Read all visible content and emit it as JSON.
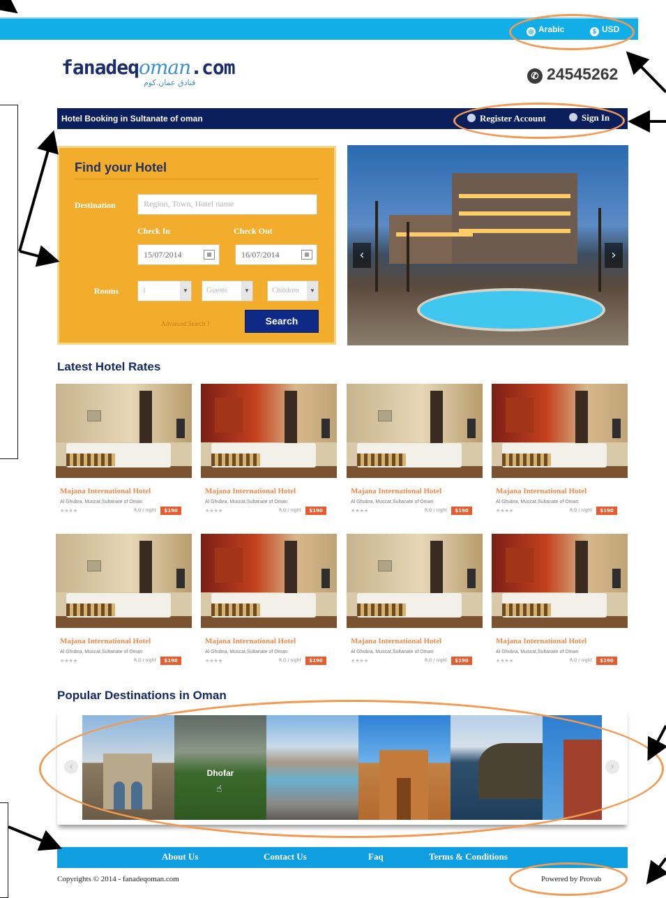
{
  "topbar": {
    "language_label": "Arabic",
    "currency_label": "USD"
  },
  "header": {
    "logo_part1": "fanadeq",
    "logo_part2": "oman",
    "logo_part3": ".com",
    "logo_arabic": "فنادق عمان.كوم",
    "phone": "24545262"
  },
  "navbar": {
    "title": "Hotel Booking in Sultanate of oman",
    "register_label": "Register Account",
    "signin_label": "Sign In"
  },
  "search": {
    "heading": "Find your Hotel",
    "destination_label": "Destination",
    "destination_placeholder": "Region, Town, Hotel name",
    "checkin_label": "Check In",
    "checkout_label": "Check Out",
    "checkin_value": "15/07/2014",
    "checkout_value": "16/07/2014",
    "rooms_label": "Rooms",
    "rooms_value": "1",
    "guests_value": "Guests",
    "children_value": "Children",
    "advanced_label": "Advanced Search ?",
    "search_button": "Search"
  },
  "latest": {
    "heading": "Latest Hotel Rates",
    "hotels": [
      {
        "name": "Majana International Hotel",
        "address": "Al Ghubra, Muscat,Sultanate of Oman",
        "stars": "★★★★",
        "per": "R.O / night",
        "price": "$190"
      },
      {
        "name": "Majana International Hotel",
        "address": "Al Ghubra, Muscat,Sultanate of Oman",
        "stars": "★★★★",
        "per": "R.O / night",
        "price": "$190"
      },
      {
        "name": "Majana International Hotel",
        "address": "Al Ghubra, Muscat,Sultanate of Oman",
        "stars": "★★★★",
        "per": "R.O / night",
        "price": "$190"
      },
      {
        "name": "Majana International Hotel",
        "address": "Al Ghubra, Muscat,Sultanate of Oman",
        "stars": "★★★★",
        "per": "R.O / night",
        "price": "$190"
      },
      {
        "name": "Majana International Hotel",
        "address": "Al Ghubra, Muscat,Sultanate of Oman",
        "stars": "★★★★",
        "per": "R.O / night",
        "price": "$190"
      },
      {
        "name": "Majana International Hotel",
        "address": "Al Ghubra, Muscat,Sultanate of Oman",
        "stars": "★★★★",
        "per": "R.O / night",
        "price": "$190"
      },
      {
        "name": "Majana International Hotel",
        "address": "Al Ghubra, Muscat,Sultanate of Oman",
        "stars": "★★★★",
        "per": "R.O / night",
        "price": "$190"
      },
      {
        "name": "Majana International Hotel",
        "address": "Al Ghubra, Muscat,Sultanate of Oman",
        "stars": "★★★★",
        "per": "R.O / night",
        "price": "$190"
      }
    ]
  },
  "popular": {
    "heading": "Popular Destinations in Oman",
    "hover_label": "Dhofar"
  },
  "footer": {
    "links": [
      "About Us",
      "Contact Us",
      "Faq",
      "Terms & Conditions"
    ],
    "copyright": "Copyrights © 2014 - fanadeqoman.com",
    "powered": "Powered by Provab"
  },
  "colors": {
    "topbar": "#12aee7",
    "navbar": "#0a1f5c",
    "findbox": "#f2ad2d",
    "search_button": "#0f2a86",
    "hotel_name": "#f08a4b",
    "price_badge": "#e85b2e",
    "annotation": "#f29a52"
  }
}
